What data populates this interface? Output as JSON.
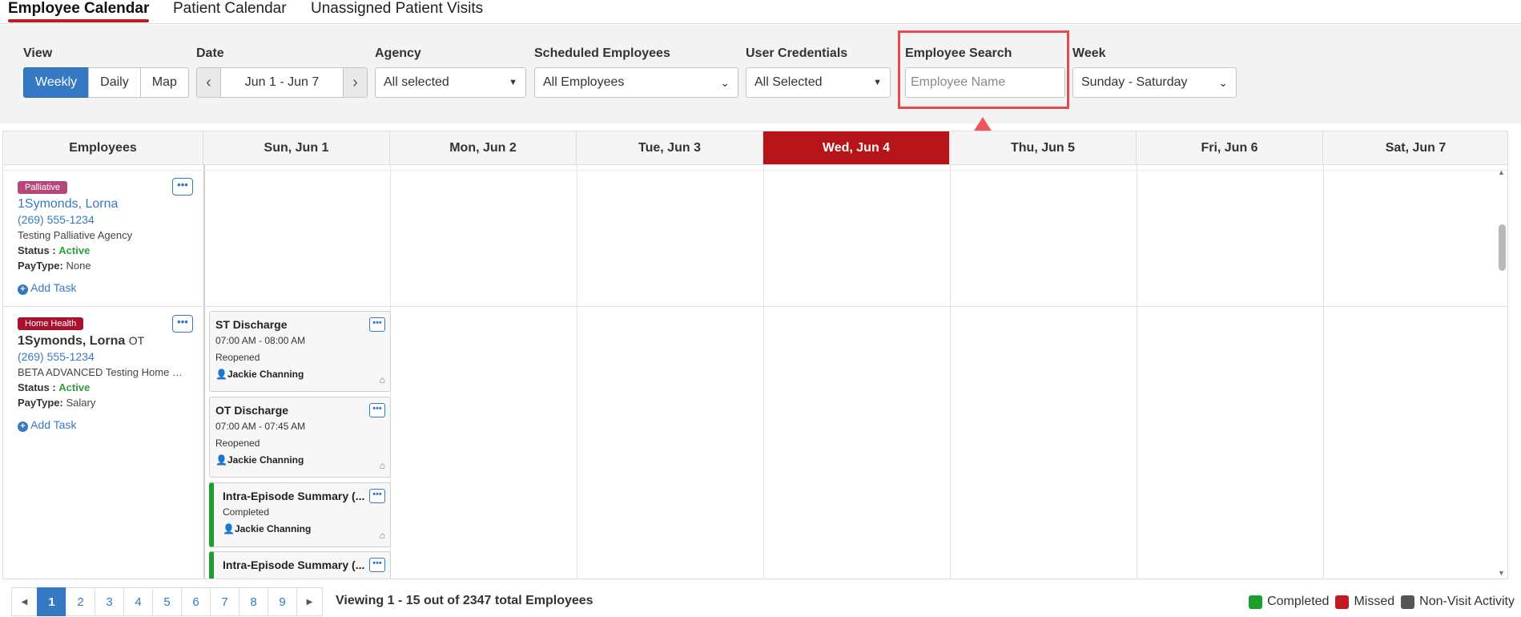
{
  "tabs": [
    "Employee Calendar",
    "Patient Calendar",
    "Unassigned Patient Visits"
  ],
  "filters": {
    "view": {
      "label": "View",
      "options": [
        "Weekly",
        "Daily",
        "Map"
      ],
      "selected": "Weekly"
    },
    "date": {
      "label": "Date",
      "value": "Jun 1 - Jun 7"
    },
    "agency": {
      "label": "Agency",
      "value": "All selected"
    },
    "scheduled_employees": {
      "label": "Scheduled Employees",
      "value": "All Employees"
    },
    "user_credentials": {
      "label": "User Credentials",
      "value": "All Selected"
    },
    "employee_search": {
      "label": "Employee Search",
      "placeholder": "Employee Name"
    },
    "week": {
      "label": "Week",
      "value": "Sunday - Saturday"
    }
  },
  "grid": {
    "employees_header": "Employees",
    "days": [
      "Sun, Jun 1",
      "Mon, Jun 2",
      "Tue, Jun 3",
      "Wed, Jun 4",
      "Thu, Jun 5",
      "Fri, Jun 6",
      "Sat, Jun 7"
    ],
    "today": "Wed, Jun 4",
    "today_color": "#b71419"
  },
  "employees": [
    {
      "badge": "Palliative",
      "badge_color": "#b5487a",
      "name": "1Symonds, Lorna",
      "credential": "",
      "phone": "(269) 555-1234",
      "agency": "Testing Palliative Agency",
      "status_label": "Status :",
      "status": "Active",
      "paytype_label": "PayType:",
      "paytype": "None",
      "add_task": "Add Task"
    },
    {
      "badge": "Home Health",
      "badge_color": "#a8122e",
      "name": "1Symonds, Lorna",
      "credential": "OT",
      "phone": "(269) 555-1234",
      "agency": "BETA ADVANCED Testing Home Health Agency",
      "status_label": "Status :",
      "status": "Active",
      "paytype_label": "PayType:",
      "paytype": "Salary",
      "add_task": "Add Task"
    }
  ],
  "tasks": [
    {
      "title": "ST Discharge",
      "time": "07:00 AM - 08:00 AM",
      "status": "Reopened",
      "assignee": "Jackie Channing"
    },
    {
      "title": "OT Discharge",
      "time": "07:00 AM - 07:45 AM",
      "status": "Reopened",
      "assignee": "Jackie Channing"
    },
    {
      "title": "Intra-Episode Summary (...",
      "time": "",
      "status": "Completed",
      "assignee": "Jackie Channing",
      "status_color": "#1e9e2e"
    },
    {
      "title": "Intra-Episode Summary (...",
      "time": "",
      "status": "",
      "assignee": "",
      "status_color": "#1e9e2e"
    }
  ],
  "pagination": {
    "pages": [
      "1",
      "2",
      "3",
      "4",
      "5",
      "6",
      "7",
      "8",
      "9"
    ],
    "current": "1",
    "viewing_text": "Viewing 1 - 15 out of 2347 total Employees"
  },
  "legend": [
    {
      "label": "Completed",
      "color": "#1e9e2e"
    },
    {
      "label": "Missed",
      "color": "#c11a1f"
    },
    {
      "label": "Non-Visit Activity",
      "color": "#555555"
    }
  ],
  "icons": {
    "ellipsis": "more-icon",
    "person": "user-icon",
    "home": "home-icon",
    "plus": "plus-circle-icon",
    "caret": "caret-down-icon",
    "chevron": "chevron-down-icon"
  }
}
